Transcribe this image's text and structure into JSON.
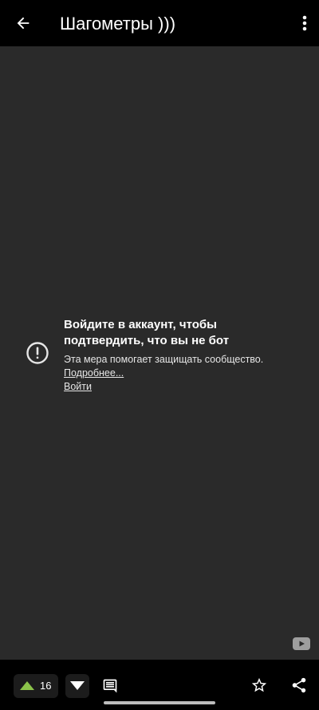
{
  "header": {
    "title": "Шагометры )))",
    "back_icon": "arrow-left-icon",
    "menu_icon": "more-vert-icon"
  },
  "video": {
    "background": "#2a2a2a",
    "alert": {
      "icon": "error-outline-icon",
      "heading": "Войдите в аккаунт, чтобы подтвердить, что вы не бот",
      "subtext": "Эта мера помогает защищать сообщество.",
      "more_link": "Подробнее...",
      "signin_link": "Войти"
    },
    "watermark_icon": "youtube-icon"
  },
  "bottom_bar": {
    "upvote_icon": "triangle-up-icon",
    "upvote_color": "#8bc34a",
    "vote_count": "16",
    "downvote_icon": "triangle-down-icon",
    "comment_icon": "comment-icon",
    "favorite_icon": "star-outline-icon",
    "share_icon": "share-icon"
  }
}
